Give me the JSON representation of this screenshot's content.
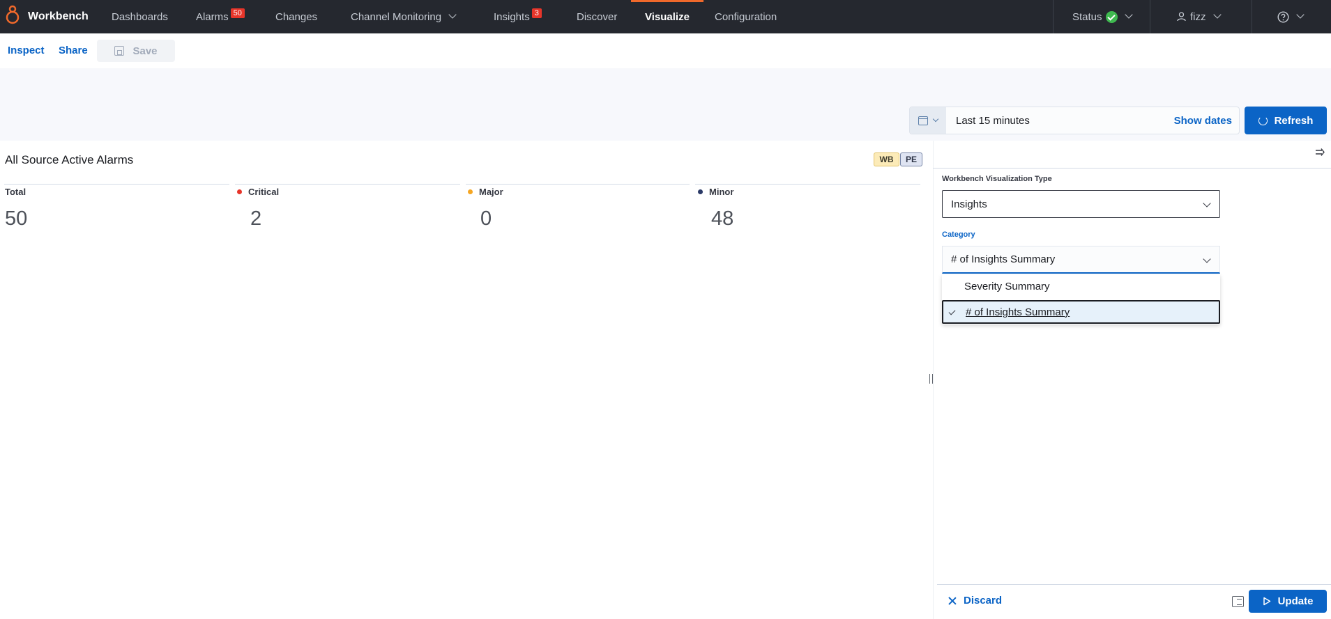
{
  "app": {
    "name": "Workbench"
  },
  "nav": {
    "dashboards": "Dashboards",
    "alarms": "Alarms",
    "alarms_badge": "50",
    "changes": "Changes",
    "channel_monitoring": "Channel Monitoring",
    "insights": "Insights",
    "insights_badge": "3",
    "discover": "Discover",
    "visualize": "Visualize",
    "configuration": "Configuration",
    "status": "Status",
    "user": "fizz",
    "accent_color": "#f0692b"
  },
  "toolbar": {
    "inspect": "Inspect",
    "share": "Share",
    "save": "Save"
  },
  "time": {
    "range": "Last 15 minutes",
    "show_dates": "Show dates",
    "refresh": "Refresh"
  },
  "panel": {
    "title": "All Source Active Alarms",
    "chip_wb": "WB",
    "chip_pe": "PE",
    "metrics": [
      {
        "label": "Total",
        "value": "50",
        "color": ""
      },
      {
        "label": "Critical",
        "value": "2",
        "color": "#e7352a"
      },
      {
        "label": "Major",
        "value": "0",
        "color": "#f5a623"
      },
      {
        "label": "Minor",
        "value": "48",
        "color": "#2b3a67"
      }
    ]
  },
  "editor": {
    "type_label": "Workbench Visualization Type",
    "type_value": "Insights",
    "category_label": "Category",
    "category_value": "# of Insights Summary",
    "options": [
      "Severity Summary",
      "# of Insights Summary"
    ],
    "selected_option": "# of Insights Summary",
    "discard": "Discard",
    "update": "Update"
  }
}
